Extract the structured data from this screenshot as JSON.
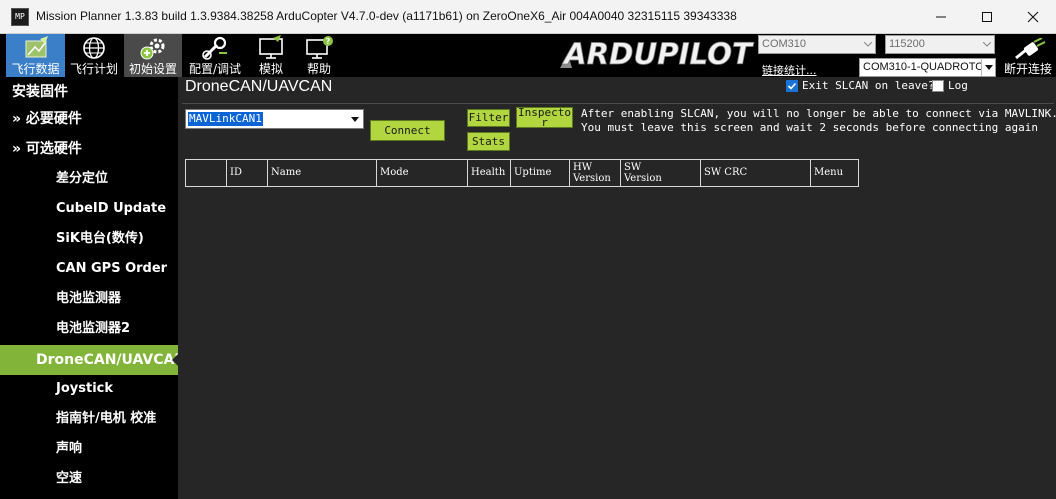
{
  "window": {
    "title": "Mission Planner 1.3.83 build 1.3.9384.38258 ArduCopter V4.7.0-dev (a1171b61) on ZeroOneX6_Air 004A0040 32315115 39343338",
    "app_icon_text": "MP"
  },
  "toolbar": {
    "items": [
      {
        "label": "飞行数据",
        "icon": "flight-data-icon"
      },
      {
        "label": "飞行计划",
        "icon": "flight-plan-globe-icon"
      },
      {
        "label": "初始设置",
        "icon": "initial-setup-gears-icon"
      },
      {
        "label": "配置/调试",
        "icon": "config-tuning-wrench-icon"
      },
      {
        "label": "模拟",
        "icon": "simulation-monitor-icon"
      },
      {
        "label": "帮助",
        "icon": "help-monitor-icon"
      }
    ],
    "logo_text": "ARDUPILOT",
    "com_port": "COM310",
    "baud_rate": "115200",
    "link_stats": "链接统计...",
    "connection": "COM310-1-QUADROTOR",
    "disconnect_label": "断开连接"
  },
  "sidebar": {
    "items": [
      {
        "label": "安装固件"
      },
      {
        "label": "» 必要硬件"
      },
      {
        "label": "» 可选硬件"
      },
      {
        "label": "差分定位"
      },
      {
        "label": "CubeID Update"
      },
      {
        "label": "SiK电台(数传)"
      },
      {
        "label": "CAN GPS Order"
      },
      {
        "label": "电池监测器"
      },
      {
        "label": "电池监测器2"
      },
      {
        "label": "DroneCAN/UAVCAN"
      },
      {
        "label": "Joystick"
      },
      {
        "label": "指南针/电机 校准"
      },
      {
        "label": "声响"
      },
      {
        "label": "空速"
      }
    ]
  },
  "main": {
    "title": "DroneCAN/UAVCAN",
    "exit_slcan_label": "Exit SLCAN on leave?",
    "exit_slcan_checked": true,
    "log_label": "Log",
    "log_checked": false,
    "interface_select": "MAVLinkCAN1",
    "connect_label": "Connect",
    "filter_label": "Filter",
    "stats_label": "Stats",
    "inspector_line1": "Inspecto",
    "inspector_line2": "r",
    "info_line1": "After enabling SLCAN, you will no longer be able to connect via MAVLINK.",
    "info_line2": "You must leave this screen and wait 2 seconds before connecting again",
    "table_headers": [
      {
        "l1": "",
        "l2": ""
      },
      {
        "l1": "ID",
        "l2": ""
      },
      {
        "l1": "Name",
        "l2": ""
      },
      {
        "l1": "Mode",
        "l2": ""
      },
      {
        "l1": "Health",
        "l2": ""
      },
      {
        "l1": "Uptime",
        "l2": ""
      },
      {
        "l1": "HW",
        "l2": "Version"
      },
      {
        "l1": "SW",
        "l2": "Version"
      },
      {
        "l1": "SW CRC",
        "l2": ""
      },
      {
        "l1": "Menu",
        "l2": ""
      }
    ]
  },
  "colors": {
    "accent_green": "#82b43a",
    "button_green": "#b2d63f",
    "active_tab_blue": "#3b7fc9",
    "panel_bg": "#262626"
  }
}
